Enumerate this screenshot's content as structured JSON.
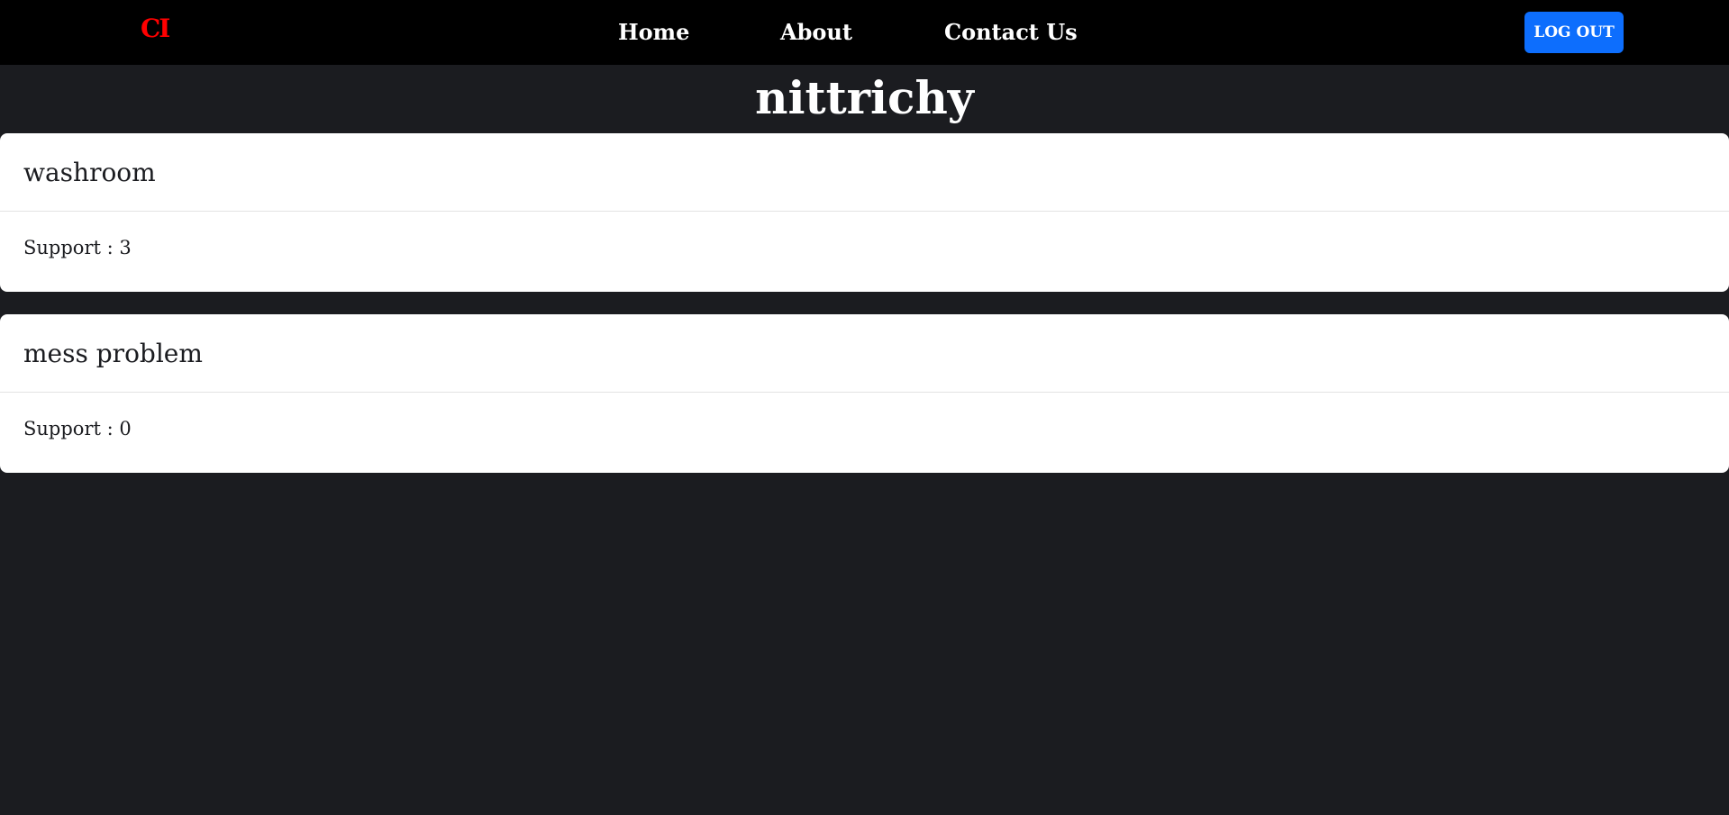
{
  "navbar": {
    "brand": "CI",
    "links": [
      {
        "label": "Home"
      },
      {
        "label": "About"
      },
      {
        "label": "Contact Us"
      }
    ],
    "logout_label": "LOG OUT"
  },
  "page": {
    "title": "nittrichy"
  },
  "complaints": [
    {
      "title": "washroom",
      "support": "Support : 3"
    },
    {
      "title": "mess problem",
      "support": "Support : 0"
    }
  ],
  "colors": {
    "navbar_bg": "#000000",
    "page_bg": "#1b1c20",
    "brand": "#ff0000",
    "logout_button": "#0d6efd",
    "card_bg": "#ffffff"
  }
}
